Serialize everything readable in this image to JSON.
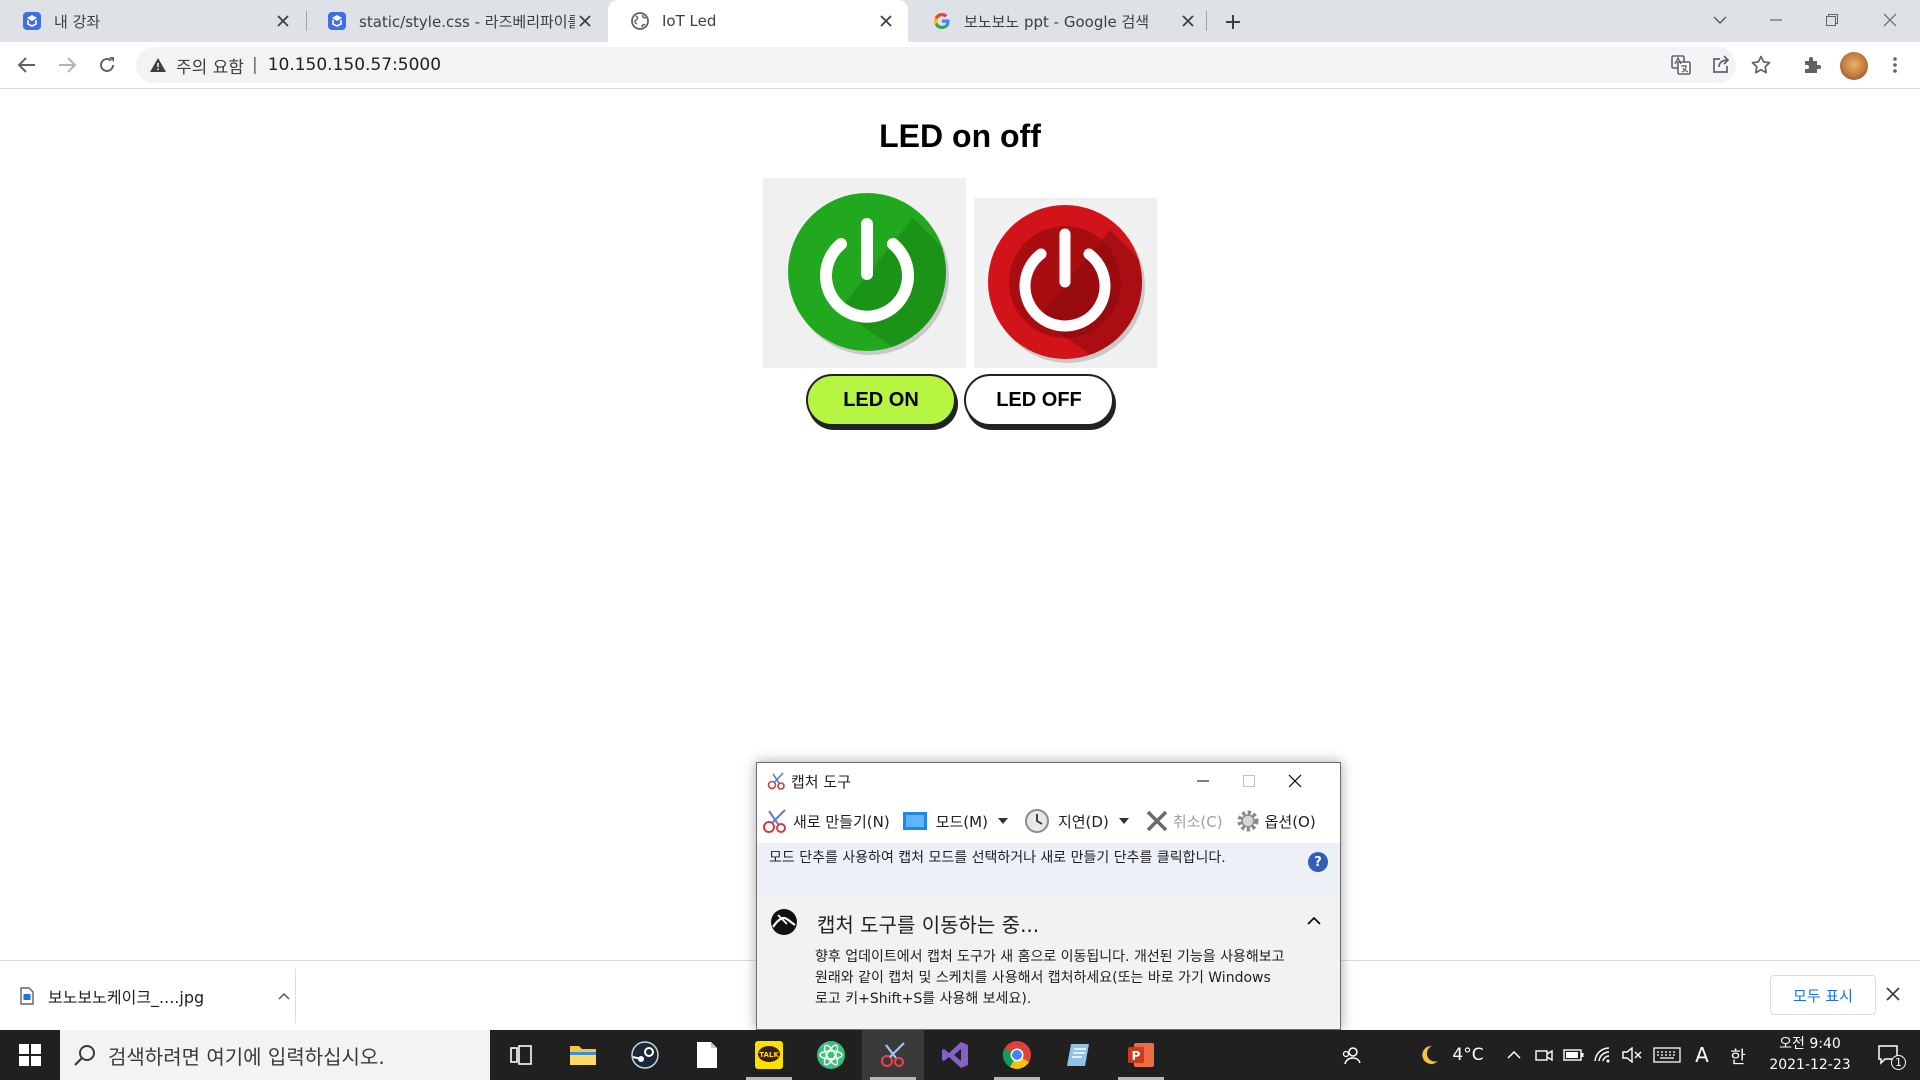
{
  "browser": {
    "tabs": [
      {
        "title": "내 강좌",
        "favicon": "classroom-favicon",
        "active": false
      },
      {
        "title": "static/style.css - 라즈베리파이를",
        "favicon": "classroom-favicon",
        "active": false
      },
      {
        "title": "IoT Led",
        "favicon": "globe-favicon",
        "active": true
      },
      {
        "title": "보노보노 ppt - Google 검색",
        "favicon": "google-favicon",
        "active": false
      }
    ],
    "new_tab_label": "+",
    "address": {
      "security_label": "주의 요함",
      "separator": "|",
      "url": "10.150.150.57:5000"
    }
  },
  "page": {
    "heading": "LED on off",
    "buttons": {
      "on_label": "LED ON",
      "off_label": "LED OFF"
    },
    "colors": {
      "on_button": "#b6f542",
      "off_button": "#ffffff",
      "green_icon": "#22a81e",
      "red_icon": "#d3131a"
    }
  },
  "downloads": {
    "file_name": "보노보노케이크_....jpg",
    "show_all": "모두 표시"
  },
  "snipping_tool": {
    "title": "캡처 도구",
    "toolbar": {
      "new": "새로 만들기(N)",
      "mode": "모드(M)",
      "delay": "지연(D)",
      "cancel": "취소(C)",
      "options": "옵션(O)"
    },
    "info": "모드 단추를 사용하여 캡처 모드를 선택하거나 새로 만들기 단추를 클릭합니다.",
    "notice_title": "캡처 도구를 이동하는 중...",
    "notice_body": "향후 업데이트에서 캡처 도구가 새 홈으로 이동됩니다. 개선된 기능을 사용해보고 원래와 같이 캡처 및 스케치를 사용해서 캡처하세요(또는 바로 가기 Windows 로고 키+Shift+S를 사용해 보세요)."
  },
  "taskbar": {
    "search_placeholder": "검색하려면 여기에 입력하십시오.",
    "weather": "4°C",
    "ime_a": "A",
    "ime_lang": "한",
    "time": "오전 9:40",
    "date": "2021-12-23",
    "notifications": "1"
  }
}
